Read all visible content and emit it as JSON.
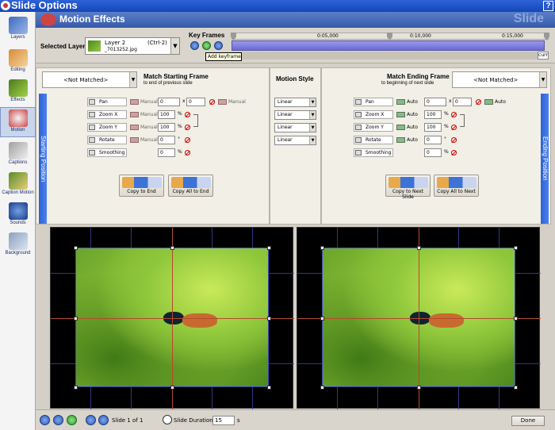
{
  "window": {
    "title": "Slide Options",
    "help_label": "?"
  },
  "sidebar": {
    "items": [
      {
        "label": "Layers",
        "icon": "layers-icon"
      },
      {
        "label": "Editing",
        "icon": "editing-icon"
      },
      {
        "label": "Effects",
        "icon": "effects-icon"
      },
      {
        "label": "Motion",
        "icon": "motion-icon",
        "active": true
      },
      {
        "label": "Captions",
        "icon": "captions-icon"
      },
      {
        "label": "Caption Motion",
        "icon": "caption-motion-icon"
      },
      {
        "label": "Sounds",
        "icon": "sounds-icon"
      },
      {
        "label": "Background",
        "icon": "background-icon"
      }
    ]
  },
  "header": {
    "title": "Motion Effects",
    "watermark": "Slide"
  },
  "layer": {
    "label": "Selected Layer",
    "name": "Layer  2",
    "shortcut": "(Ctrl-2)",
    "file": "_7013252.jpg"
  },
  "keyframes": {
    "label": "Key Frames",
    "ticks": [
      "0:05,000",
      "0:10,000",
      "0:15,000"
    ],
    "end_label": "curr",
    "tooltip": "Add keyframe"
  },
  "start": {
    "band_label": "Starting Position",
    "match_value": "<Not Matched>",
    "title": "Match Starting Frame",
    "subtitle": "to end of previous slide",
    "pan": {
      "label": "Pan",
      "x": "0",
      "sep": "x",
      "y": "0"
    },
    "zoom_x": {
      "label": "Zoom X",
      "value": "100",
      "unit": "%"
    },
    "zoom_y": {
      "label": "Zoom Y",
      "value": "100",
      "unit": "%"
    },
    "rotate": {
      "label": "Rotate",
      "value": "0",
      "unit": "°"
    },
    "smoothing": {
      "label": "Smoothing",
      "value": "0",
      "unit": "%"
    },
    "mode_label": "Manual",
    "copy_end": "Copy to End",
    "copy_all_end": "Copy All to End"
  },
  "motion_style": {
    "label": "Motion Style",
    "options": [
      "Linear",
      "Linear",
      "Linear",
      "Linear"
    ]
  },
  "end": {
    "band_label": "Ending Position",
    "match_value": "<Not Matched>",
    "title": "Match Ending Frame",
    "subtitle": "to beginning of next slide",
    "pan": {
      "label": "Pan",
      "x": "0",
      "sep": "x",
      "y": "0"
    },
    "zoom_x": {
      "label": "Zoom X",
      "value": "100",
      "unit": "%"
    },
    "zoom_y": {
      "label": "Zoom Y",
      "value": "100",
      "unit": "%"
    },
    "rotate": {
      "label": "Rotate",
      "value": "0",
      "unit": "°"
    },
    "smoothing": {
      "label": "Smoothing",
      "value": "0",
      "unit": "%"
    },
    "mode_label": "Auto",
    "copy_next": "Copy to Next Slide",
    "copy_all_next": "Copy All to Next"
  },
  "footer": {
    "slide_counter": "Slide 1 of 1",
    "duration_label": "Slide Duration",
    "duration_value": "15",
    "duration_unit": "s",
    "done": "Done"
  },
  "colors": {
    "title_bar": "#1f50c4",
    "accent_band": "#3c72e0",
    "panel_bg": "#f2efe6"
  }
}
